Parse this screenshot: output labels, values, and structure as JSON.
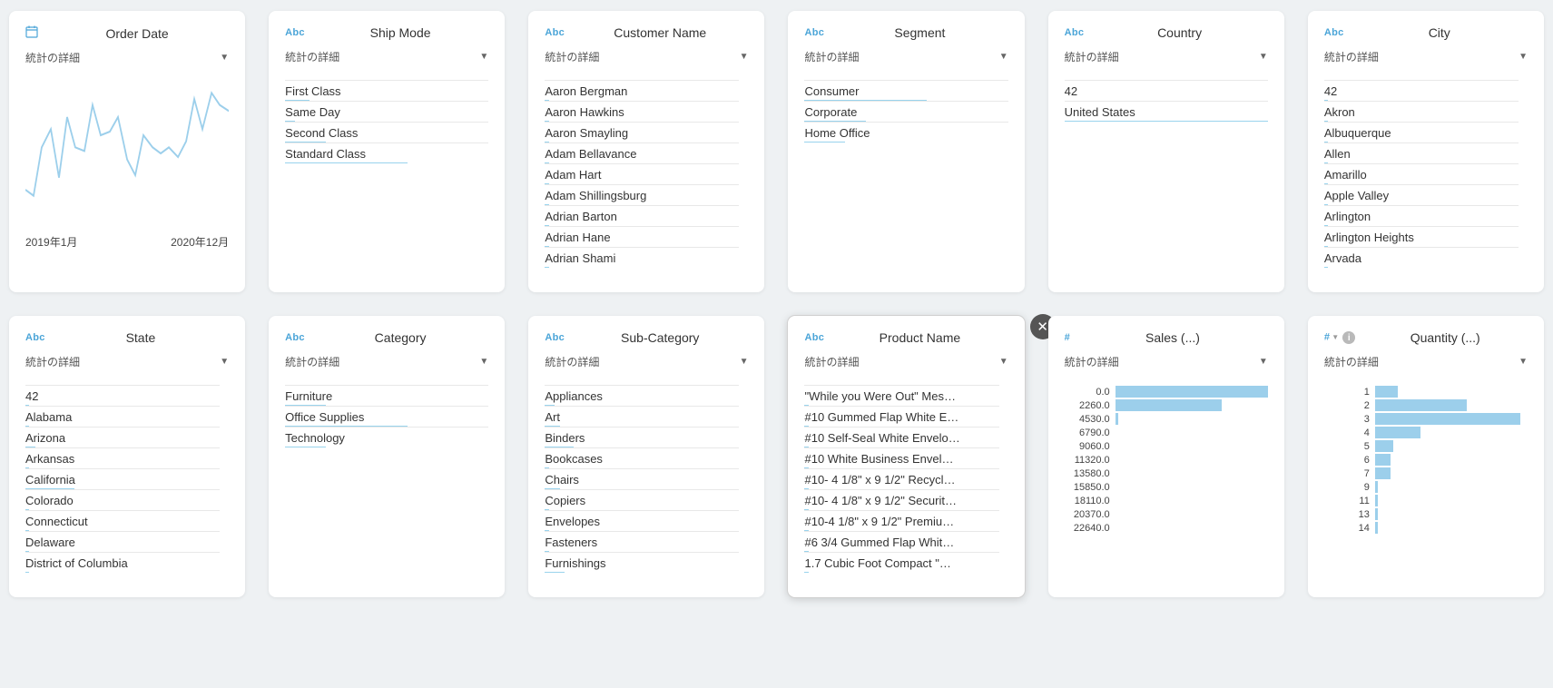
{
  "dropdown_label": "統計の詳細",
  "cards": {
    "order_date": {
      "type_icon": "date",
      "title": "Order Date",
      "axis_start": "2019年1月",
      "axis_end": "2020年12月"
    },
    "ship_mode": {
      "type_icon": "Abc",
      "title": "Ship Mode",
      "items": [
        {
          "label": "First Class",
          "bar": 12
        },
        {
          "label": "Same Day",
          "bar": 5
        },
        {
          "label": "Second Class",
          "bar": 20
        },
        {
          "label": "Standard Class",
          "bar": 60
        }
      ]
    },
    "customer_name": {
      "type_icon": "Abc",
      "title": "Customer Name",
      "items": [
        {
          "label": "Aaron Bergman",
          "bar": 2
        },
        {
          "label": "Aaron Hawkins",
          "bar": 2
        },
        {
          "label": "Aaron Smayling",
          "bar": 2
        },
        {
          "label": "Adam Bellavance",
          "bar": 2
        },
        {
          "label": "Adam Hart",
          "bar": 2
        },
        {
          "label": "Adam Shillingsburg",
          "bar": 2
        },
        {
          "label": "Adrian Barton",
          "bar": 2
        },
        {
          "label": "Adrian Hane",
          "bar": 2
        },
        {
          "label": "Adrian Shami",
          "bar": 2
        }
      ]
    },
    "segment": {
      "type_icon": "Abc",
      "title": "Segment",
      "items": [
        {
          "label": "Consumer",
          "bar": 60
        },
        {
          "label": "Corporate",
          "bar": 30
        },
        {
          "label": "Home Office",
          "bar": 20
        }
      ]
    },
    "country": {
      "type_icon": "Abc",
      "title": "Country",
      "items": [
        {
          "label": "42",
          "bar": 0
        },
        {
          "label": "United States",
          "bar": 100
        }
      ]
    },
    "city": {
      "type_icon": "Abc",
      "title": "City",
      "items": [
        {
          "label": "42",
          "bar": 2
        },
        {
          "label": "Akron",
          "bar": 2
        },
        {
          "label": "Albuquerque",
          "bar": 2
        },
        {
          "label": "Allen",
          "bar": 2
        },
        {
          "label": "Amarillo",
          "bar": 2
        },
        {
          "label": "Apple Valley",
          "bar": 2
        },
        {
          "label": "Arlington",
          "bar": 2
        },
        {
          "label": "Arlington Heights",
          "bar": 2
        },
        {
          "label": "Arvada",
          "bar": 2
        }
      ]
    },
    "state": {
      "type_icon": "Abc",
      "title": "State",
      "items": [
        {
          "label": "42",
          "bar": 2
        },
        {
          "label": "Alabama",
          "bar": 2
        },
        {
          "label": "Arizona",
          "bar": 5
        },
        {
          "label": "Arkansas",
          "bar": 2
        },
        {
          "label": "California",
          "bar": 25
        },
        {
          "label": "Colorado",
          "bar": 2
        },
        {
          "label": "Connecticut",
          "bar": 2
        },
        {
          "label": "Delaware",
          "bar": 2
        },
        {
          "label": "District of Columbia",
          "bar": 2
        }
      ]
    },
    "category": {
      "type_icon": "Abc",
      "title": "Category",
      "items": [
        {
          "label": "Furniture",
          "bar": 20
        },
        {
          "label": "Office Supplies",
          "bar": 60
        },
        {
          "label": "Technology",
          "bar": 20
        }
      ]
    },
    "sub_category": {
      "type_icon": "Abc",
      "title": "Sub-Category",
      "items": [
        {
          "label": "Appliances",
          "bar": 5
        },
        {
          "label": "Art",
          "bar": 8
        },
        {
          "label": "Binders",
          "bar": 15
        },
        {
          "label": "Bookcases",
          "bar": 2
        },
        {
          "label": "Chairs",
          "bar": 8
        },
        {
          "label": "Copiers",
          "bar": 2
        },
        {
          "label": "Envelopes",
          "bar": 2
        },
        {
          "label": "Fasteners",
          "bar": 2
        },
        {
          "label": "Furnishings",
          "bar": 10
        }
      ]
    },
    "product_name": {
      "type_icon": "Abc",
      "title": "Product Name",
      "items": [
        {
          "label": "\"While you Were Out\" Mes…",
          "bar": 2
        },
        {
          "label": "#10 Gummed Flap White E…",
          "bar": 2
        },
        {
          "label": "#10 Self-Seal White Envelo…",
          "bar": 2
        },
        {
          "label": "#10 White Business Envel…",
          "bar": 2
        },
        {
          "label": "#10- 4 1/8\" x 9 1/2\" Recycl…",
          "bar": 2
        },
        {
          "label": "#10- 4 1/8\" x 9 1/2\" Securit…",
          "bar": 2
        },
        {
          "label": "#10-4 1/8\" x 9 1/2\" Premiu…",
          "bar": 2
        },
        {
          "label": "#6 3/4 Gummed Flap Whit…",
          "bar": 2
        },
        {
          "label": "1.7 Cubic Foot Compact \"…",
          "bar": 2
        }
      ]
    },
    "sales": {
      "type_icon": "#",
      "title": "Sales (...)",
      "labels": [
        "0.0",
        "2260.0",
        "4530.0",
        "6790.0",
        "9060.0",
        "11320.0",
        "13580.0",
        "15850.0",
        "18110.0",
        "20370.0",
        "22640.0"
      ],
      "values": [
        100,
        70,
        2,
        0,
        0,
        0,
        0,
        0,
        0,
        0,
        0
      ]
    },
    "quantity": {
      "type_icon": "#",
      "title": "Quantity (...)",
      "labels": [
        "1",
        "2",
        "3",
        "4",
        "5",
        "6",
        "7",
        "9",
        "11",
        "13",
        "14"
      ],
      "values": [
        15,
        60,
        95,
        30,
        12,
        10,
        10,
        2,
        2,
        2,
        2
      ]
    }
  },
  "chart_data": [
    {
      "type": "line",
      "title": "Order Date",
      "x": [
        "2019-01",
        "2019-02",
        "2019-03",
        "2019-04",
        "2019-05",
        "2019-06",
        "2019-07",
        "2019-08",
        "2019-09",
        "2019-10",
        "2019-11",
        "2019-12",
        "2020-01",
        "2020-02",
        "2020-03",
        "2020-04",
        "2020-05",
        "2020-06",
        "2020-07",
        "2020-08",
        "2020-09",
        "2020-10",
        "2020-11",
        "2020-12"
      ],
      "series": [
        {
          "name": "count",
          "values": [
            30,
            25,
            60,
            75,
            40,
            80,
            58,
            55,
            90,
            68,
            72,
            85,
            50,
            40,
            70,
            60,
            55,
            60,
            52,
            65,
            95,
            70,
            98,
            90
          ]
        }
      ],
      "xlim": [
        "2019年1月",
        "2020年12月"
      ]
    },
    {
      "type": "bar",
      "title": "Sales (...)",
      "orientation": "horizontal",
      "categories": [
        "0.0",
        "2260.0",
        "4530.0",
        "6790.0",
        "9060.0",
        "11320.0",
        "13580.0",
        "15850.0",
        "18110.0",
        "20370.0",
        "22640.0"
      ],
      "values": [
        100,
        70,
        2,
        0,
        0,
        0,
        0,
        0,
        0,
        0,
        0
      ]
    },
    {
      "type": "bar",
      "title": "Quantity (...)",
      "orientation": "horizontal",
      "categories": [
        "1",
        "2",
        "3",
        "4",
        "5",
        "6",
        "7",
        "9",
        "11",
        "13",
        "14"
      ],
      "values": [
        15,
        60,
        95,
        30,
        12,
        10,
        10,
        2,
        2,
        2,
        2
      ]
    }
  ]
}
